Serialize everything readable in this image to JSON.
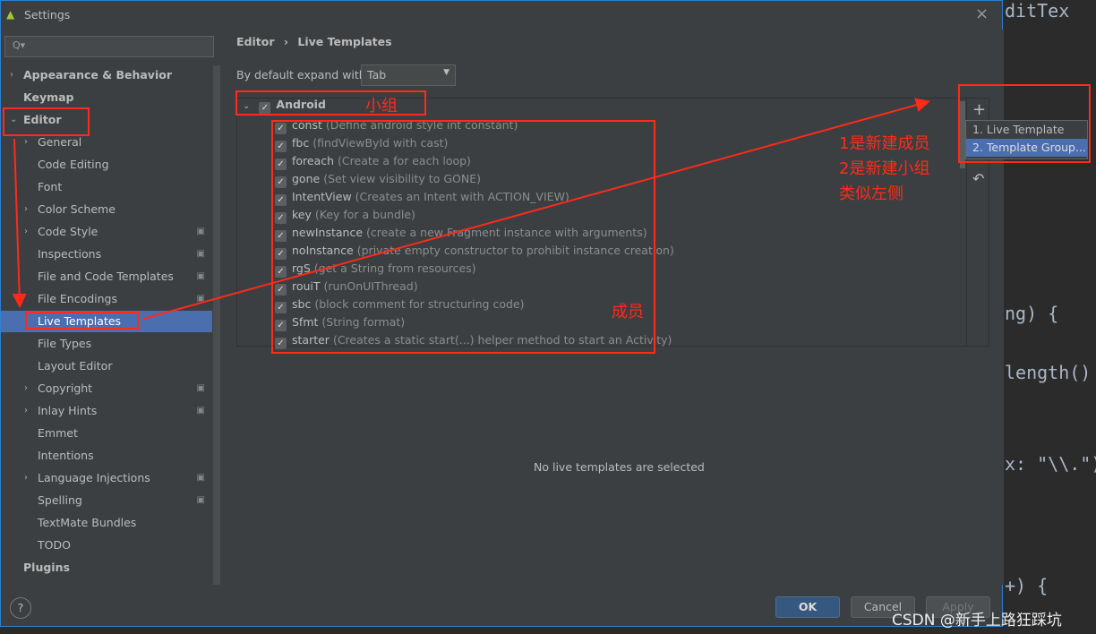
{
  "window": {
    "title": "Settings",
    "close": "×"
  },
  "search": {
    "placeholder": "Q▾"
  },
  "sidebar": {
    "items": [
      {
        "label": "Appearance & Behavior",
        "arrow": "›",
        "bold": true
      },
      {
        "label": "Keymap",
        "bold": true
      },
      {
        "label": "Editor",
        "arrow": "⌄",
        "bold": true
      },
      {
        "label": "General",
        "arrow": "›"
      },
      {
        "label": "Code Editing"
      },
      {
        "label": "Font"
      },
      {
        "label": "Color Scheme",
        "arrow": "›"
      },
      {
        "label": "Code Style",
        "arrow": "›",
        "cfg": true
      },
      {
        "label": "Inspections",
        "cfg": true
      },
      {
        "label": "File and Code Templates",
        "cfg": true
      },
      {
        "label": "File Encodings",
        "cfg": true
      },
      {
        "label": "Live Templates",
        "selected": true
      },
      {
        "label": "File Types"
      },
      {
        "label": "Layout Editor"
      },
      {
        "label": "Copyright",
        "arrow": "›",
        "cfg": true
      },
      {
        "label": "Inlay Hints",
        "arrow": "›",
        "cfg": true
      },
      {
        "label": "Emmet"
      },
      {
        "label": "Intentions"
      },
      {
        "label": "Language Injections",
        "arrow": "›",
        "cfg": true
      },
      {
        "label": "Spelling",
        "cfg": true
      },
      {
        "label": "TextMate Bundles"
      },
      {
        "label": "TODO"
      },
      {
        "label": "Plugins",
        "bold": true
      }
    ]
  },
  "breadcrumb": {
    "parent": "Editor",
    "sep": "›",
    "current": "Live Templates"
  },
  "expand": {
    "label": "By default expand with",
    "value": "Tab"
  },
  "group": {
    "name": "Android",
    "checked": true
  },
  "templates": [
    {
      "abbr": "const",
      "desc": "(Define android style int constant)"
    },
    {
      "abbr": "fbc",
      "desc": "(findViewById with cast)"
    },
    {
      "abbr": "foreach",
      "desc": "(Create a for each loop)"
    },
    {
      "abbr": "gone",
      "desc": "(Set view visibility to GONE)"
    },
    {
      "abbr": "IntentView",
      "desc": "(Creates an Intent with ACTION_VIEW)"
    },
    {
      "abbr": "key",
      "desc": "(Key for a bundle)"
    },
    {
      "abbr": "newInstance",
      "desc": "(create a new Fragment instance with arguments)"
    },
    {
      "abbr": "noInstance",
      "desc": "(private empty constructor to prohibit instance creation)"
    },
    {
      "abbr": "rgS",
      "desc": "(get a String from resources)"
    },
    {
      "abbr": "rouiT",
      "desc": "(runOnUIThread)"
    },
    {
      "abbr": "sbc",
      "desc": "(block comment for structuring code)"
    },
    {
      "abbr": "Sfmt",
      "desc": "(String format)"
    },
    {
      "abbr": "starter",
      "desc": "(Creates a static start(...) helper method to start an Activity)"
    }
  ],
  "toolbar": {
    "add": "+",
    "revert": "↶"
  },
  "add_menu": [
    "1. Live Template",
    "2. Template Group..."
  ],
  "empty_text": "No live templates are selected",
  "buttons": {
    "ok": "OK",
    "cancel": "Cancel",
    "apply": "Apply",
    "help": "?"
  },
  "annotations": {
    "group": "小组",
    "members": "成员",
    "note1": "1是新建成员",
    "note2": "2是新建小组",
    "note3": "类似左侧"
  },
  "code_bg": [
    "ditTex",
    "ng) {",
    "length()",
    "x: \"\\\\.\");",
    "+) {"
  ],
  "watermark": "CSDN @新手上路狂踩坑",
  "colors": {
    "selection": "#4b6eaf",
    "annotation": "#ff2a1a",
    "dialog_bg": "#3c3f41"
  }
}
